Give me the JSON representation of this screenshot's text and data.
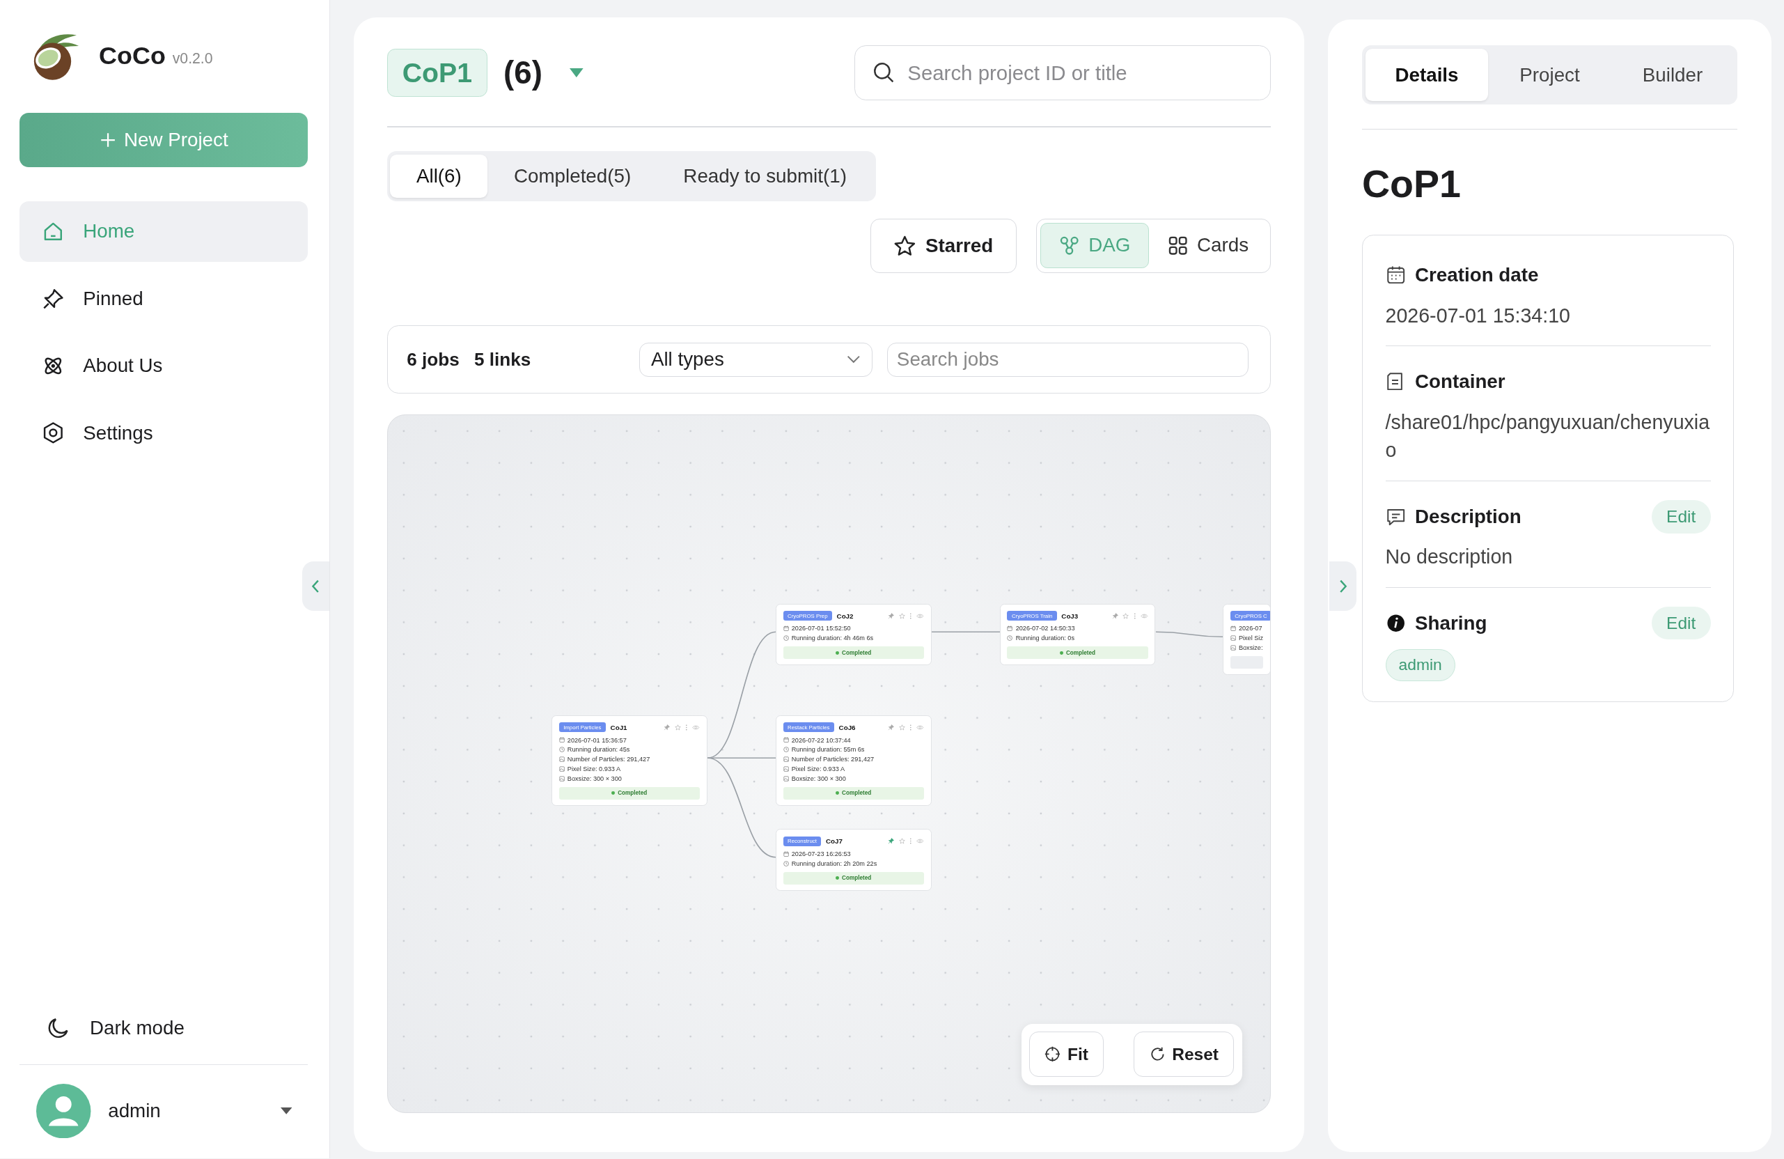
{
  "app": {
    "name": "CoCo",
    "version": "v0.2.0"
  },
  "sidebar": {
    "new_project": "New Project",
    "items": [
      {
        "label": "Home",
        "selected": true
      },
      {
        "label": "Pinned",
        "selected": false
      },
      {
        "label": "About Us",
        "selected": false
      },
      {
        "label": "Settings",
        "selected": false
      }
    ],
    "dark_mode": "Dark mode",
    "user": "admin"
  },
  "project": {
    "name": "CoP1",
    "count": "(6)",
    "search_placeholder": "Search project ID or title"
  },
  "filter_tabs": [
    {
      "label": "All(6)",
      "selected": true
    },
    {
      "label": "Completed(5)",
      "selected": false
    },
    {
      "label": "Ready to submit(1)",
      "selected": false
    }
  ],
  "starred_button": "Starred",
  "view_toggle": [
    {
      "label": "DAG",
      "selected": true
    },
    {
      "label": "Cards",
      "selected": false
    }
  ],
  "dag_toolbar": {
    "jobs": "6 jobs",
    "links": "5 links",
    "type_select": "All types",
    "search_placeholder": "Search jobs"
  },
  "dag": {
    "nodes": [
      {
        "type": "Import Particles",
        "title": "CoJ1",
        "pinned": false,
        "lines": [
          {
            "kind": "date",
            "text": "2026-07-01 15:36:57"
          },
          {
            "kind": "time",
            "text": "Running duration: 45s"
          },
          {
            "kind": "stat",
            "text": "Number of Particles: 291,427"
          },
          {
            "kind": "stat",
            "text": "Pixel Size: 0.933 A"
          },
          {
            "kind": "stat",
            "text": "Boxsize: 300 × 300"
          }
        ],
        "status": {
          "kind": "completed",
          "label": "Completed"
        }
      },
      {
        "type": "CryoPROS Prep",
        "title": "CoJ2",
        "pinned": false,
        "lines": [
          {
            "kind": "date",
            "text": "2026-07-01 15:52:50"
          },
          {
            "kind": "time",
            "text": "Running duration: 4h 46m 6s"
          }
        ],
        "status": {
          "kind": "completed",
          "label": "Completed"
        }
      },
      {
        "type": "CryoPROS Train",
        "title": "CoJ3",
        "pinned": false,
        "lines": [
          {
            "kind": "date",
            "text": "2026-07-02 14:50:33"
          },
          {
            "kind": "time",
            "text": "Running duration: 0s"
          }
        ],
        "status": {
          "kind": "completed",
          "label": "Completed"
        }
      },
      {
        "type": "CryoPROS C",
        "lines": [
          {
            "kind": "date",
            "text": "2026-07"
          },
          {
            "kind": "stat",
            "text": "Pixel Siz"
          },
          {
            "kind": "stat",
            "text": "Boxsize:"
          }
        ],
        "status": {
          "kind": "pending"
        }
      },
      {
        "type": "Restack Particles",
        "title": "CoJ6",
        "pinned": false,
        "lines": [
          {
            "kind": "date",
            "text": "2026-07-22 10:37:44"
          },
          {
            "kind": "time",
            "text": "Running duration: 55m 6s"
          },
          {
            "kind": "stat",
            "text": "Number of Particles: 291,427"
          },
          {
            "kind": "stat",
            "text": "Pixel Size: 0.933 A"
          },
          {
            "kind": "stat",
            "text": "Boxsize: 300 × 300"
          }
        ],
        "status": {
          "kind": "completed",
          "label": "Completed"
        }
      },
      {
        "type": "Reconstruct",
        "title": "CoJ7",
        "pinned": true,
        "lines": [
          {
            "kind": "date",
            "text": "2026-07-23 16:26:53"
          },
          {
            "kind": "time",
            "text": "Running duration: 2h 20m 22s"
          }
        ],
        "status": {
          "kind": "completed",
          "label": "Completed"
        }
      }
    ],
    "controls": [
      {
        "kind": "fit",
        "label": "Fit"
      },
      {
        "kind": "reset",
        "label": "Reset"
      }
    ]
  },
  "details_panel": {
    "tabs": [
      {
        "label": "Details",
        "selected": true
      },
      {
        "label": "Project",
        "selected": false
      },
      {
        "label": "Builder",
        "selected": false
      }
    ],
    "title": "CoP1",
    "sections": [
      {
        "kind": "date",
        "heading": "Creation date",
        "value": "2026-07-01 15:34:10"
      },
      {
        "kind": "container",
        "heading": "Container",
        "value": "/share01/hpc/pangyuxuan/chenyuxiao"
      },
      {
        "kind": "description",
        "heading": "Description",
        "value": "No description",
        "action": "Edit"
      },
      {
        "kind": "sharing",
        "heading": "Sharing",
        "action": "Edit",
        "tags": [
          "admin"
        ]
      }
    ]
  }
}
